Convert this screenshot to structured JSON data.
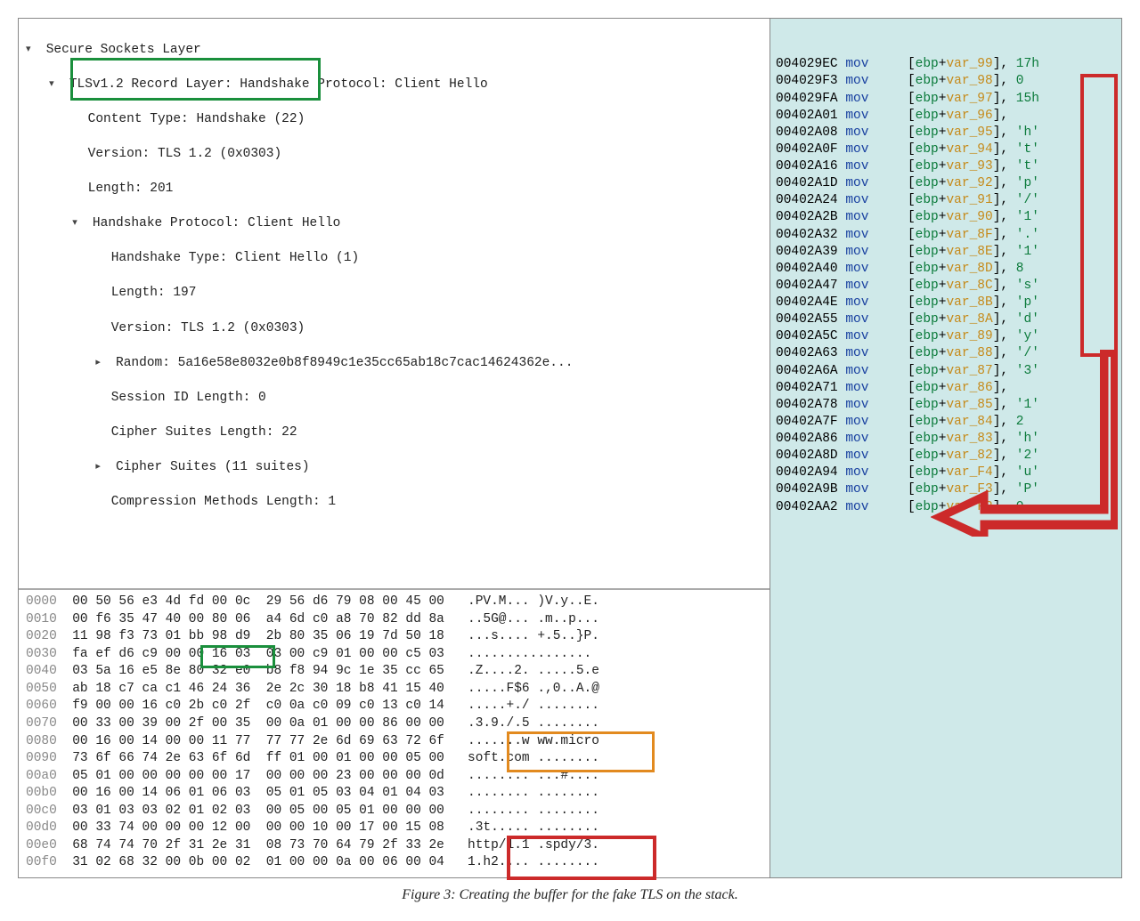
{
  "caption": "Figure 3: Creating the buffer for the fake TLS on the stack.",
  "tree": {
    "root": "Secure Sockets Layer",
    "record": "TLSv1.2 Record Layer: Handshake Protocol: Client Hello",
    "content_type": "Content Type: Handshake (22)",
    "version": "Version: TLS 1.2 (0x0303)",
    "length": "Length: 201",
    "handshake": "Handshake Protocol: Client Hello",
    "hs_type": "Handshake Type: Client Hello (1)",
    "hs_len": "Length: 197",
    "hs_ver": "Version: TLS 1.2 (0x0303)",
    "random": "Random: 5a16e58e8032e0b8f8949c1e35cc65ab18c7cac14624362e...",
    "sid": "Session ID Length: 0",
    "cs_len": "Cipher Suites Length: 22",
    "cs_list": "Cipher Suites (11 suites)",
    "comp": "Compression Methods Length: 1"
  },
  "hex": [
    {
      "off": "0000",
      "b": "00 50 56 e3 4d fd 00 0c  29 56 d6 79 08 00 45 00",
      "a": ".PV.M... )V.y..E."
    },
    {
      "off": "0010",
      "b": "00 f6 35 47 40 00 80 06  a4 6d c0 a8 70 82 dd 8a",
      "a": "..5G@... .m..p..."
    },
    {
      "off": "0020",
      "b": "11 98 f3 73 01 bb 98 d9  2b 80 35 06 19 7d 50 18",
      "a": "...s.... +.5..}P."
    },
    {
      "off": "0030",
      "b": "fa ef d6 c9 00 00 16 03  03 00 c9 01 00 00 c5 03",
      "a": "................"
    },
    {
      "off": "0040",
      "b": "03 5a 16 e5 8e 80 32 e0  b8 f8 94 9c 1e 35 cc 65",
      "a": ".Z....2. .....5.e"
    },
    {
      "off": "0050",
      "b": "ab 18 c7 ca c1 46 24 36  2e 2c 30 18 b8 41 15 40",
      "a": ".....F$6 .,0..A.@"
    },
    {
      "off": "0060",
      "b": "f9 00 00 16 c0 2b c0 2f  c0 0a c0 09 c0 13 c0 14",
      "a": ".....+./ ........"
    },
    {
      "off": "0070",
      "b": "00 33 00 39 00 2f 00 35  00 0a 01 00 00 86 00 00",
      "a": ".3.9./.5 ........"
    },
    {
      "off": "0080",
      "b": "00 16 00 14 00 00 11 77  77 77 2e 6d 69 63 72 6f",
      "a": ".......w ww.micro"
    },
    {
      "off": "0090",
      "b": "73 6f 66 74 2e 63 6f 6d  ff 01 00 01 00 00 05 00",
      "a": "soft.com ........"
    },
    {
      "off": "00a0",
      "b": "05 01 00 00 00 00 00 17  00 00 00 23 00 00 00 0d",
      "a": "........ ...#...."
    },
    {
      "off": "00b0",
      "b": "00 16 00 14 06 01 06 03  05 01 05 03 04 01 04 03",
      "a": "........ ........"
    },
    {
      "off": "00c0",
      "b": "03 01 03 03 02 01 02 03  00 05 00 05 01 00 00 00",
      "a": "........ ........"
    },
    {
      "off": "00d0",
      "b": "00 33 74 00 00 00 12 00  00 00 10 00 17 00 15 08",
      "a": ".3t..... ........"
    },
    {
      "off": "00e0",
      "b": "68 74 74 70 2f 31 2e 31  08 73 70 64 79 2f 33 2e",
      "a": "http/1.1 .spdy/3."
    },
    {
      "off": "00f0",
      "b": "31 02 68 32 00 0b 00 02  01 00 00 0a 00 06 00 04",
      "a": "1.h2.... ........"
    }
  ],
  "asm": [
    {
      "addr": "004029EC",
      "var": "var_99",
      "val": "17h"
    },
    {
      "addr": "004029F3",
      "var": "var_98",
      "val": "0"
    },
    {
      "addr": "004029FA",
      "var": "var_97",
      "val": "15h"
    },
    {
      "addr": "00402A01",
      "var": "var_96",
      "val": ""
    },
    {
      "addr": "00402A08",
      "var": "var_95",
      "val": "'h'"
    },
    {
      "addr": "00402A0F",
      "var": "var_94",
      "val": "'t'"
    },
    {
      "addr": "00402A16",
      "var": "var_93",
      "val": "'t'"
    },
    {
      "addr": "00402A1D",
      "var": "var_92",
      "val": "'p'"
    },
    {
      "addr": "00402A24",
      "var": "var_91",
      "val": "'/'"
    },
    {
      "addr": "00402A2B",
      "var": "var_90",
      "val": "'1'"
    },
    {
      "addr": "00402A32",
      "var": "var_8F",
      "val": "'.'"
    },
    {
      "addr": "00402A39",
      "var": "var_8E",
      "val": "'1'"
    },
    {
      "addr": "00402A40",
      "var": "var_8D",
      "val": "8"
    },
    {
      "addr": "00402A47",
      "var": "var_8C",
      "val": "'s'"
    },
    {
      "addr": "00402A4E",
      "var": "var_8B",
      "val": "'p'"
    },
    {
      "addr": "00402A55",
      "var": "var_8A",
      "val": "'d'"
    },
    {
      "addr": "00402A5C",
      "var": "var_89",
      "val": "'y'"
    },
    {
      "addr": "00402A63",
      "var": "var_88",
      "val": "'/'"
    },
    {
      "addr": "00402A6A",
      "var": "var_87",
      "val": "'3'"
    },
    {
      "addr": "00402A71",
      "var": "var_86",
      "val": ""
    },
    {
      "addr": "00402A78",
      "var": "var_85",
      "val": "'1'"
    },
    {
      "addr": "00402A7F",
      "var": "var_84",
      "val": "2"
    },
    {
      "addr": "00402A86",
      "var": "var_83",
      "val": "'h'"
    },
    {
      "addr": "00402A8D",
      "var": "var_82",
      "val": "'2'"
    },
    {
      "addr": "00402A94",
      "var": "var_F4",
      "val": "'u'"
    },
    {
      "addr": "00402A9B",
      "var": "var_F3",
      "val": "'P'"
    },
    {
      "addr": "00402AA2",
      "var": "var F2",
      "val": "0"
    }
  ]
}
